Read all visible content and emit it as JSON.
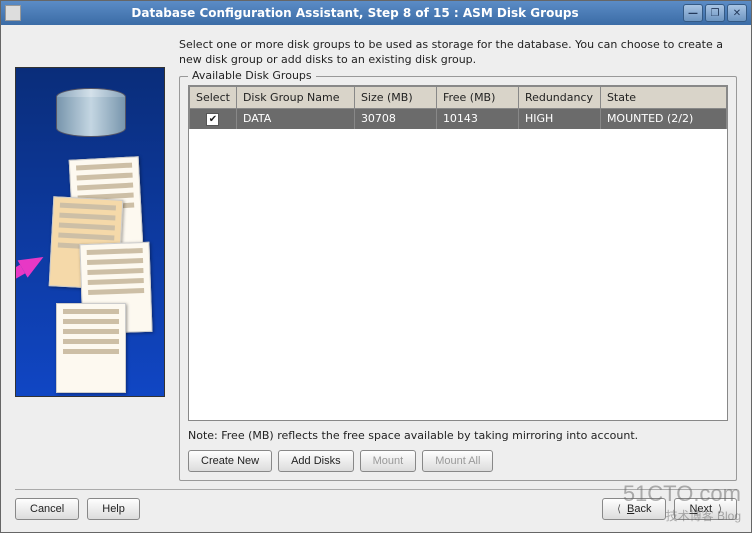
{
  "window": {
    "title": "Database Configuration Assistant, Step 8 of 15 : ASM Disk Groups"
  },
  "intro": "Select one or more disk groups to be used as storage for the database. You can choose to create a new disk group or add disks to an existing disk group.",
  "fieldset_title": "Available Disk Groups",
  "table": {
    "headers": {
      "select": "Select",
      "name": "Disk Group Name",
      "size": "Size (MB)",
      "free": "Free (MB)",
      "redundancy": "Redundancy",
      "state": "State"
    },
    "rows": [
      {
        "selected": true,
        "name": "DATA",
        "size": "30708",
        "free": "10143",
        "redundancy": "HIGH",
        "state": "MOUNTED (2/2)"
      }
    ]
  },
  "note": "Note: Free (MB) reflects the free space available by taking mirroring into account.",
  "buttons": {
    "create_new": "Create New",
    "add_disks": "Add Disks",
    "mount": "Mount",
    "mount_all": "Mount All"
  },
  "footer": {
    "cancel": "Cancel",
    "help": "Help",
    "back": "Back",
    "next": "Next"
  },
  "watermark": {
    "main": "51CTO.com",
    "sub": "技术博客  Blog"
  }
}
